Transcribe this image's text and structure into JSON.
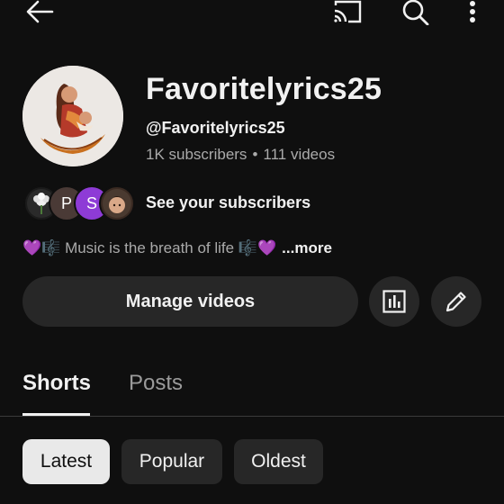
{
  "topbar": {
    "back_icon": "arrow-left-icon",
    "cast_icon": "cast-icon",
    "search_icon": "search-icon",
    "more_icon": "more-vertical-icon"
  },
  "channel": {
    "name": "Favoritelyrics25",
    "handle": "@Favoritelyrics25",
    "subscribers": "1K subscribers",
    "separator": "•",
    "videos": "111 videos"
  },
  "subscribers_row": {
    "avatars": [
      {
        "kind": "image",
        "name": "subscriber-avatar-flower"
      },
      {
        "kind": "letter",
        "letter": "P",
        "color": "#4a3a36"
      },
      {
        "kind": "letter",
        "letter": "S",
        "color": "#8e3bd6"
      },
      {
        "kind": "image",
        "name": "subscriber-avatar-photo"
      }
    ],
    "label": "See your subscribers"
  },
  "description": {
    "lead_emoji": "💜🎼",
    "text": " Music is the breath of life ",
    "trail_emoji": "🎼💜",
    "more_label": "...more"
  },
  "actions": {
    "manage_videos_label": "Manage videos",
    "analytics_icon": "analytics-icon",
    "edit_icon": "pencil-icon"
  },
  "tabs": [
    {
      "label": "Shorts",
      "active": true
    },
    {
      "label": "Posts",
      "active": false
    }
  ],
  "chips": [
    {
      "label": "Latest",
      "selected": true
    },
    {
      "label": "Popular",
      "selected": false
    },
    {
      "label": "Oldest",
      "selected": false
    }
  ],
  "colors": {
    "background": "#0f0f0f",
    "surface": "#272727",
    "secondary_text": "#aaaaaa",
    "accent_purple": "#8e3bd6"
  }
}
